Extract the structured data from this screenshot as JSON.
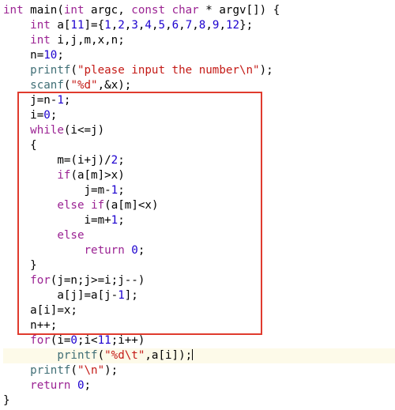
{
  "colors": {
    "keyword": "#9b2393",
    "number": "#1c00cf",
    "string": "#c41a16",
    "function": "#3f6e75",
    "highlight_box": "#e03b2e",
    "current_line_bg": "#fdfae9"
  },
  "highlight_box": {
    "from_line": 6,
    "to_line": 20
  },
  "cursor_line": 22,
  "tokens": [
    [
      [
        "kw",
        "int"
      ],
      [
        "plain",
        " main("
      ],
      [
        "kw",
        "int"
      ],
      [
        "plain",
        " argc, "
      ],
      [
        "type",
        "const"
      ],
      [
        "plain",
        " "
      ],
      [
        "type",
        "char"
      ],
      [
        "plain",
        " * argv[]) {"
      ]
    ],
    [
      [
        "plain",
        "    "
      ],
      [
        "kw",
        "int"
      ],
      [
        "plain",
        " a["
      ],
      [
        "num",
        "11"
      ],
      [
        "plain",
        "]={"
      ],
      [
        "num",
        "1"
      ],
      [
        "plain",
        ","
      ],
      [
        "num",
        "2"
      ],
      [
        "plain",
        ","
      ],
      [
        "num",
        "3"
      ],
      [
        "plain",
        ","
      ],
      [
        "num",
        "4"
      ],
      [
        "plain",
        ","
      ],
      [
        "num",
        "5"
      ],
      [
        "plain",
        ","
      ],
      [
        "num",
        "6"
      ],
      [
        "plain",
        ","
      ],
      [
        "num",
        "7"
      ],
      [
        "plain",
        ","
      ],
      [
        "num",
        "8"
      ],
      [
        "plain",
        ","
      ],
      [
        "num",
        "9"
      ],
      [
        "plain",
        ","
      ],
      [
        "num",
        "12"
      ],
      [
        "plain",
        "};"
      ]
    ],
    [
      [
        "plain",
        "    "
      ],
      [
        "kw",
        "int"
      ],
      [
        "plain",
        " i,j,m,x,n;"
      ]
    ],
    [
      [
        "plain",
        "    n="
      ],
      [
        "num",
        "10"
      ],
      [
        "plain",
        ";"
      ]
    ],
    [
      [
        "plain",
        "    "
      ],
      [
        "fn",
        "printf"
      ],
      [
        "plain",
        "("
      ],
      [
        "str",
        "\"please input the number\\n\""
      ],
      [
        "plain",
        ");"
      ]
    ],
    [
      [
        "plain",
        "    "
      ],
      [
        "fn",
        "scanf"
      ],
      [
        "plain",
        "("
      ],
      [
        "str",
        "\"%d\""
      ],
      [
        "plain",
        ",&x);"
      ]
    ],
    [
      [
        "plain",
        "    j=n-"
      ],
      [
        "num",
        "1"
      ],
      [
        "plain",
        ";"
      ]
    ],
    [
      [
        "plain",
        "    i="
      ],
      [
        "num",
        "0"
      ],
      [
        "plain",
        ";"
      ]
    ],
    [
      [
        "plain",
        "    "
      ],
      [
        "kw",
        "while"
      ],
      [
        "plain",
        "(i<=j)"
      ]
    ],
    [
      [
        "plain",
        "    {"
      ]
    ],
    [
      [
        "plain",
        "        m=(i+j)/"
      ],
      [
        "num",
        "2"
      ],
      [
        "plain",
        ";"
      ]
    ],
    [
      [
        "plain",
        "        "
      ],
      [
        "kw",
        "if"
      ],
      [
        "plain",
        "(a[m]>x)"
      ]
    ],
    [
      [
        "plain",
        "            j=m-"
      ],
      [
        "num",
        "1"
      ],
      [
        "plain",
        ";"
      ]
    ],
    [
      [
        "plain",
        "        "
      ],
      [
        "kw",
        "else"
      ],
      [
        "plain",
        " "
      ],
      [
        "kw",
        "if"
      ],
      [
        "plain",
        "(a[m]<x)"
      ]
    ],
    [
      [
        "plain",
        "            i=m+"
      ],
      [
        "num",
        "1"
      ],
      [
        "plain",
        ";"
      ]
    ],
    [
      [
        "plain",
        "        "
      ],
      [
        "kw",
        "else"
      ]
    ],
    [
      [
        "plain",
        "            "
      ],
      [
        "kw",
        "return"
      ],
      [
        "plain",
        " "
      ],
      [
        "num",
        "0"
      ],
      [
        "plain",
        ";"
      ]
    ],
    [
      [
        "plain",
        "    }"
      ]
    ],
    [
      [
        "plain",
        "    "
      ],
      [
        "kw",
        "for"
      ],
      [
        "plain",
        "(j=n;j>=i;j--)"
      ]
    ],
    [
      [
        "plain",
        "        a[j]=a[j-"
      ],
      [
        "num",
        "1"
      ],
      [
        "plain",
        "];"
      ]
    ],
    [
      [
        "plain",
        "    a[i]=x;"
      ]
    ],
    [
      [
        "plain",
        "    n++;"
      ]
    ],
    [
      [
        "plain",
        "    "
      ],
      [
        "kw",
        "for"
      ],
      [
        "plain",
        "(i="
      ],
      [
        "num",
        "0"
      ],
      [
        "plain",
        ";i<"
      ],
      [
        "num",
        "11"
      ],
      [
        "plain",
        ";i++)"
      ]
    ],
    [
      [
        "plain",
        "        "
      ],
      [
        "fn",
        "printf"
      ],
      [
        "plain",
        "("
      ],
      [
        "str",
        "\"%d\\t\""
      ],
      [
        "plain",
        ",a[i]);"
      ],
      [
        "cursor",
        ""
      ]
    ],
    [
      [
        "plain",
        "    "
      ],
      [
        "fn",
        "printf"
      ],
      [
        "plain",
        "("
      ],
      [
        "str",
        "\"\\n\""
      ],
      [
        "plain",
        ");"
      ]
    ],
    [
      [
        "plain",
        "    "
      ],
      [
        "kw",
        "return"
      ],
      [
        "plain",
        " "
      ],
      [
        "num",
        "0"
      ],
      [
        "plain",
        ";"
      ]
    ],
    [
      [
        "plain",
        "}"
      ]
    ]
  ]
}
